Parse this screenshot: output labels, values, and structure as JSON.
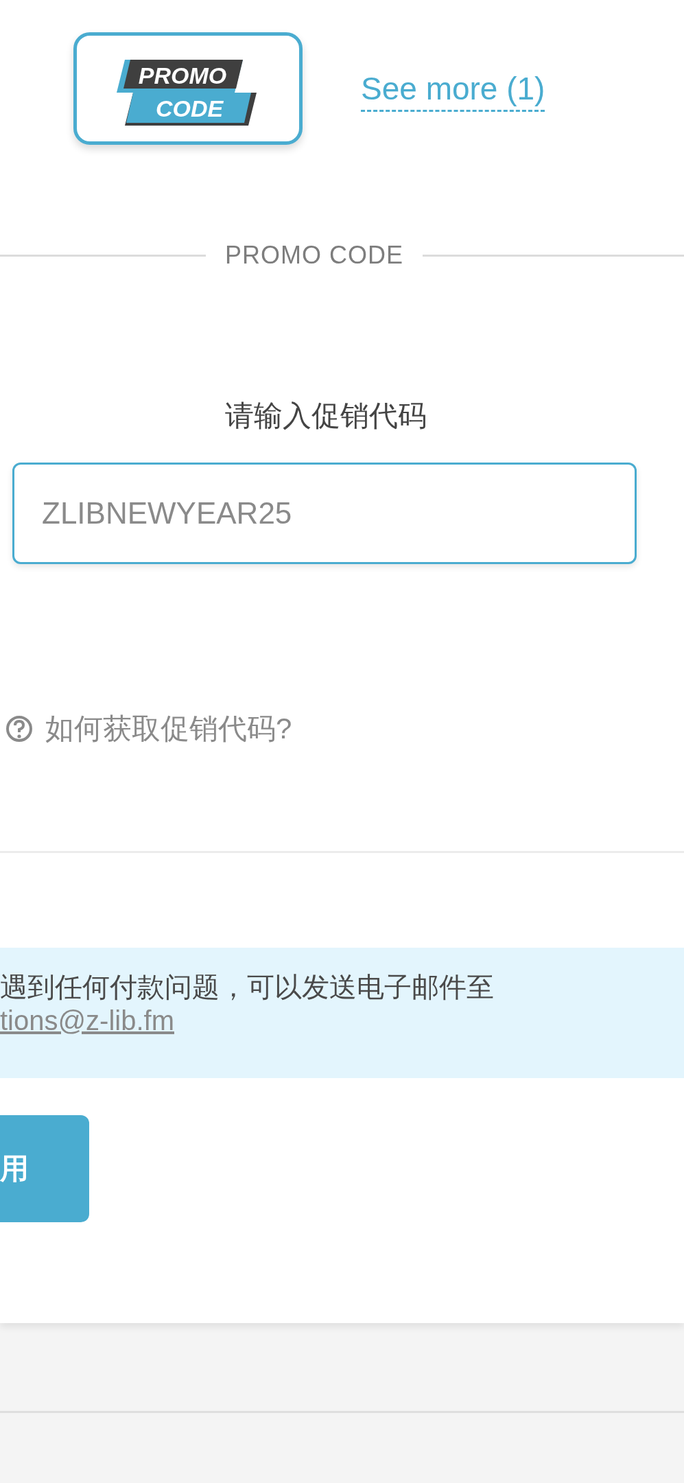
{
  "logo": {
    "lines": [
      "PROMO",
      "CODE"
    ]
  },
  "see_more": {
    "label": "See more (1)"
  },
  "section": {
    "title": "PROMO CODE"
  },
  "form": {
    "heading": "请输入促销代码",
    "input": {
      "value": "ZLIBNEWYEAR25"
    },
    "help_link": "如何获取促销代码?"
  },
  "notice": {
    "text": "遇到任何付款问题，可以发送电子邮件至",
    "email": "tions@z-lib.fm"
  },
  "apply_button": {
    "label": "用"
  }
}
